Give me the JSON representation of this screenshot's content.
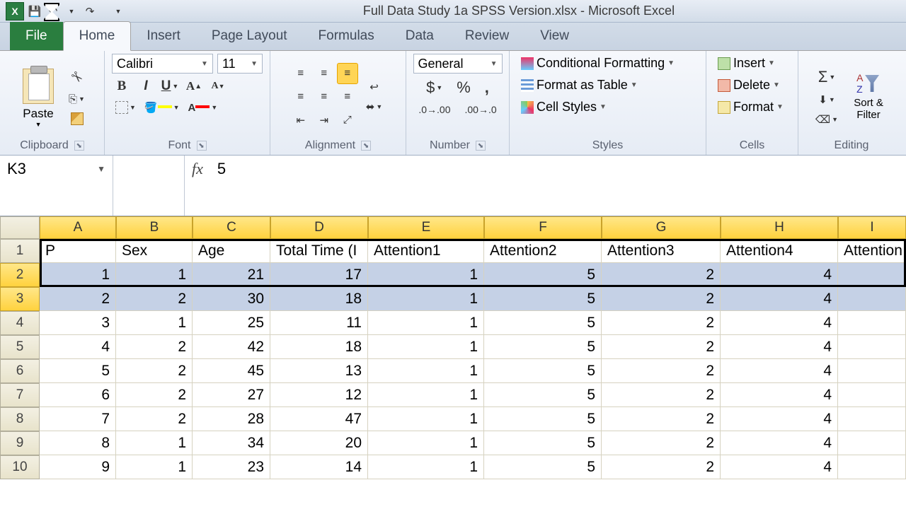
{
  "window": {
    "title": "Full Data Study 1a SPSS Version.xlsx - Microsoft Excel"
  },
  "tabs": {
    "file": "File",
    "home": "Home",
    "insert": "Insert",
    "pageLayout": "Page Layout",
    "formulas": "Formulas",
    "data": "Data",
    "review": "Review",
    "view": "View"
  },
  "ribbon": {
    "clipboard": {
      "paste": "Paste",
      "label": "Clipboard"
    },
    "font": {
      "name": "Calibri",
      "size": "11",
      "label": "Font"
    },
    "alignment": {
      "label": "Alignment"
    },
    "number": {
      "format": "General",
      "label": "Number"
    },
    "styles": {
      "cond": "Conditional Formatting",
      "table": "Format as Table",
      "cell": "Cell Styles",
      "label": "Styles"
    },
    "cells": {
      "insert": "Insert",
      "delete": "Delete",
      "format": "Format",
      "label": "Cells"
    },
    "editing": {
      "sort": "Sort & Filter",
      "label": "Editing"
    }
  },
  "nameBox": "K3",
  "formula": "5",
  "columns": [
    "A",
    "B",
    "C",
    "D",
    "E",
    "F",
    "G",
    "H",
    "I"
  ],
  "headers": [
    "P",
    "Sex",
    "Age",
    "Total Time (I",
    "Attention1",
    "Attention2",
    "Attention3",
    "Attention4",
    "Attention"
  ],
  "rows": [
    [
      "1",
      "1",
      "21",
      "17",
      "1",
      "5",
      "2",
      "4",
      ""
    ],
    [
      "2",
      "2",
      "30",
      "18",
      "1",
      "5",
      "2",
      "4",
      ""
    ],
    [
      "3",
      "1",
      "25",
      "11",
      "1",
      "5",
      "2",
      "4",
      ""
    ],
    [
      "4",
      "2",
      "42",
      "18",
      "1",
      "5",
      "2",
      "4",
      ""
    ],
    [
      "5",
      "2",
      "45",
      "13",
      "1",
      "5",
      "2",
      "4",
      ""
    ],
    [
      "6",
      "2",
      "27",
      "12",
      "1",
      "5",
      "2",
      "4",
      ""
    ],
    [
      "7",
      "2",
      "28",
      "47",
      "1",
      "5",
      "2",
      "4",
      ""
    ],
    [
      "8",
      "1",
      "34",
      "20",
      "1",
      "5",
      "2",
      "4",
      ""
    ],
    [
      "9",
      "1",
      "23",
      "14",
      "1",
      "5",
      "2",
      "4",
      ""
    ]
  ]
}
